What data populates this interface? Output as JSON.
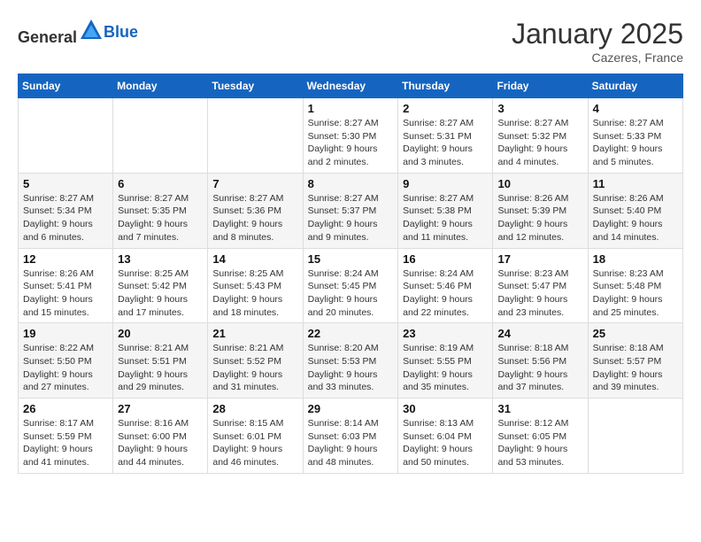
{
  "header": {
    "logo_general": "General",
    "logo_blue": "Blue",
    "month": "January 2025",
    "location": "Cazeres, France"
  },
  "weekdays": [
    "Sunday",
    "Monday",
    "Tuesday",
    "Wednesday",
    "Thursday",
    "Friday",
    "Saturday"
  ],
  "weeks": [
    [
      {
        "day": "",
        "sunrise": "",
        "sunset": "",
        "daylight": ""
      },
      {
        "day": "",
        "sunrise": "",
        "sunset": "",
        "daylight": ""
      },
      {
        "day": "",
        "sunrise": "",
        "sunset": "",
        "daylight": ""
      },
      {
        "day": "1",
        "sunrise": "Sunrise: 8:27 AM",
        "sunset": "Sunset: 5:30 PM",
        "daylight": "Daylight: 9 hours and 2 minutes."
      },
      {
        "day": "2",
        "sunrise": "Sunrise: 8:27 AM",
        "sunset": "Sunset: 5:31 PM",
        "daylight": "Daylight: 9 hours and 3 minutes."
      },
      {
        "day": "3",
        "sunrise": "Sunrise: 8:27 AM",
        "sunset": "Sunset: 5:32 PM",
        "daylight": "Daylight: 9 hours and 4 minutes."
      },
      {
        "day": "4",
        "sunrise": "Sunrise: 8:27 AM",
        "sunset": "Sunset: 5:33 PM",
        "daylight": "Daylight: 9 hours and 5 minutes."
      }
    ],
    [
      {
        "day": "5",
        "sunrise": "Sunrise: 8:27 AM",
        "sunset": "Sunset: 5:34 PM",
        "daylight": "Daylight: 9 hours and 6 minutes."
      },
      {
        "day": "6",
        "sunrise": "Sunrise: 8:27 AM",
        "sunset": "Sunset: 5:35 PM",
        "daylight": "Daylight: 9 hours and 7 minutes."
      },
      {
        "day": "7",
        "sunrise": "Sunrise: 8:27 AM",
        "sunset": "Sunset: 5:36 PM",
        "daylight": "Daylight: 9 hours and 8 minutes."
      },
      {
        "day": "8",
        "sunrise": "Sunrise: 8:27 AM",
        "sunset": "Sunset: 5:37 PM",
        "daylight": "Daylight: 9 hours and 9 minutes."
      },
      {
        "day": "9",
        "sunrise": "Sunrise: 8:27 AM",
        "sunset": "Sunset: 5:38 PM",
        "daylight": "Daylight: 9 hours and 11 minutes."
      },
      {
        "day": "10",
        "sunrise": "Sunrise: 8:26 AM",
        "sunset": "Sunset: 5:39 PM",
        "daylight": "Daylight: 9 hours and 12 minutes."
      },
      {
        "day": "11",
        "sunrise": "Sunrise: 8:26 AM",
        "sunset": "Sunset: 5:40 PM",
        "daylight": "Daylight: 9 hours and 14 minutes."
      }
    ],
    [
      {
        "day": "12",
        "sunrise": "Sunrise: 8:26 AM",
        "sunset": "Sunset: 5:41 PM",
        "daylight": "Daylight: 9 hours and 15 minutes."
      },
      {
        "day": "13",
        "sunrise": "Sunrise: 8:25 AM",
        "sunset": "Sunset: 5:42 PM",
        "daylight": "Daylight: 9 hours and 17 minutes."
      },
      {
        "day": "14",
        "sunrise": "Sunrise: 8:25 AM",
        "sunset": "Sunset: 5:43 PM",
        "daylight": "Daylight: 9 hours and 18 minutes."
      },
      {
        "day": "15",
        "sunrise": "Sunrise: 8:24 AM",
        "sunset": "Sunset: 5:45 PM",
        "daylight": "Daylight: 9 hours and 20 minutes."
      },
      {
        "day": "16",
        "sunrise": "Sunrise: 8:24 AM",
        "sunset": "Sunset: 5:46 PM",
        "daylight": "Daylight: 9 hours and 22 minutes."
      },
      {
        "day": "17",
        "sunrise": "Sunrise: 8:23 AM",
        "sunset": "Sunset: 5:47 PM",
        "daylight": "Daylight: 9 hours and 23 minutes."
      },
      {
        "day": "18",
        "sunrise": "Sunrise: 8:23 AM",
        "sunset": "Sunset: 5:48 PM",
        "daylight": "Daylight: 9 hours and 25 minutes."
      }
    ],
    [
      {
        "day": "19",
        "sunrise": "Sunrise: 8:22 AM",
        "sunset": "Sunset: 5:50 PM",
        "daylight": "Daylight: 9 hours and 27 minutes."
      },
      {
        "day": "20",
        "sunrise": "Sunrise: 8:21 AM",
        "sunset": "Sunset: 5:51 PM",
        "daylight": "Daylight: 9 hours and 29 minutes."
      },
      {
        "day": "21",
        "sunrise": "Sunrise: 8:21 AM",
        "sunset": "Sunset: 5:52 PM",
        "daylight": "Daylight: 9 hours and 31 minutes."
      },
      {
        "day": "22",
        "sunrise": "Sunrise: 8:20 AM",
        "sunset": "Sunset: 5:53 PM",
        "daylight": "Daylight: 9 hours and 33 minutes."
      },
      {
        "day": "23",
        "sunrise": "Sunrise: 8:19 AM",
        "sunset": "Sunset: 5:55 PM",
        "daylight": "Daylight: 9 hours and 35 minutes."
      },
      {
        "day": "24",
        "sunrise": "Sunrise: 8:18 AM",
        "sunset": "Sunset: 5:56 PM",
        "daylight": "Daylight: 9 hours and 37 minutes."
      },
      {
        "day": "25",
        "sunrise": "Sunrise: 8:18 AM",
        "sunset": "Sunset: 5:57 PM",
        "daylight": "Daylight: 9 hours and 39 minutes."
      }
    ],
    [
      {
        "day": "26",
        "sunrise": "Sunrise: 8:17 AM",
        "sunset": "Sunset: 5:59 PM",
        "daylight": "Daylight: 9 hours and 41 minutes."
      },
      {
        "day": "27",
        "sunrise": "Sunrise: 8:16 AM",
        "sunset": "Sunset: 6:00 PM",
        "daylight": "Daylight: 9 hours and 44 minutes."
      },
      {
        "day": "28",
        "sunrise": "Sunrise: 8:15 AM",
        "sunset": "Sunset: 6:01 PM",
        "daylight": "Daylight: 9 hours and 46 minutes."
      },
      {
        "day": "29",
        "sunrise": "Sunrise: 8:14 AM",
        "sunset": "Sunset: 6:03 PM",
        "daylight": "Daylight: 9 hours and 48 minutes."
      },
      {
        "day": "30",
        "sunrise": "Sunrise: 8:13 AM",
        "sunset": "Sunset: 6:04 PM",
        "daylight": "Daylight: 9 hours and 50 minutes."
      },
      {
        "day": "31",
        "sunrise": "Sunrise: 8:12 AM",
        "sunset": "Sunset: 6:05 PM",
        "daylight": "Daylight: 9 hours and 53 minutes."
      },
      {
        "day": "",
        "sunrise": "",
        "sunset": "",
        "daylight": ""
      }
    ]
  ]
}
